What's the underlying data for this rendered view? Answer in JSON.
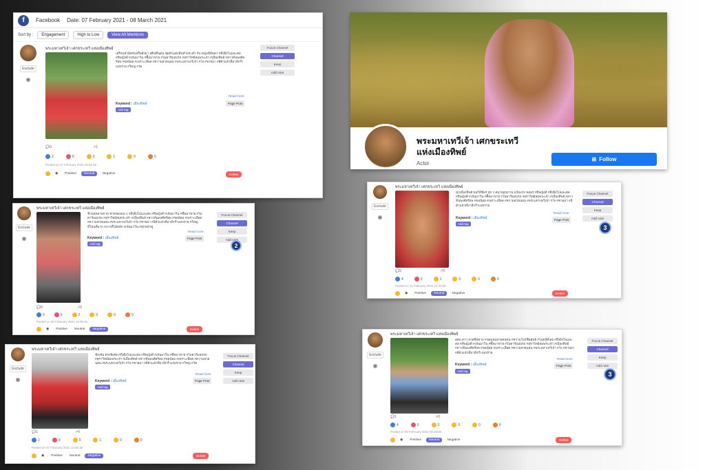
{
  "header": {
    "platform": "Facebook",
    "date_range": "Date: 07 February 2021 - 08 March 2021",
    "sort_label": "Sort by :",
    "sort_field": "Engagement",
    "sort_order": "High to Low",
    "view_all": "View All Mentions"
  },
  "profile": {
    "name_line1": "พระมหาเทวีเจ้า เศกขระเทวี",
    "name_line2": "แห่งเมืองทิพย์",
    "role": "Actor",
    "follow_label": "Follow"
  },
  "labels": {
    "exclude": "Exclude",
    "focus_channel": "Focus Channel",
    "channel": "Channel",
    "keep": "Keep",
    "add_note": "Add note",
    "read_more": "Read more",
    "keyword_label": "Keyword :",
    "keyword_value": "เมืองทิพย์",
    "add_tag": "Add tag",
    "page_post": "Page Post",
    "positive": "Positive",
    "neutral": "Neutral",
    "negative": "Negative",
    "delete": "Delete"
  },
  "posts": [
    {
      "author": "พระมหาเทวีเจ้า เศกขระเทวี แห่งเมืองทิพย์",
      "text": "เสร็จแล้วมีครบหรือยังมา สติบ่ตื่นตน ชุดตัวแต่งสีนลำพระดำ กับ หนุ่มที่สันตา #ทึ่งยิ่งไปและต่อ #ทิพญ์งดี #เจ้นมาวิน #ซื้อมาขาย #โมดาร์มอบรถ #สุราวิทย์สมพระเจ้า #เมืองทิพย์ #สาวทั่นพงศ์สรัยพ #ขอน้อย #เพราะเลือด #ความสวยนอน #พระมหาเทวีเจ้า #วัง #ชายมา #อีตัวแล้วที่มาอีกร่ำแห่งราย #ใหญ่ #วัด",
      "comments": "0",
      "shares": "1",
      "likes": "2",
      "love": "0",
      "haha": "3",
      "wow": "1",
      "sad": "0",
      "angry": "0",
      "posted": "Posted on 27 February 2021 10:31:49",
      "sentiment": "Neutral"
    },
    {
      "author": "พระมหาเทวีเจ้า เศกขระเทวี แห่งเมืองทิพย์",
      "text": "ชีวพลหลายกาม ชายของแม่ 1 #ทึ่งยิ่งไปและต่อ #ทิพญ์งดี #เจ้นมาวิน #ซื้อมาขาย #โมดาร์มอบรถ #สุราวิทย์สมพระเจ้า #เมืองทิพย์ #สาวทั่นพงศ์สรัยพ #ขอน้อย #เพราะเลือด #ความสวยนอน #พระมหาเทวีเจ้า #วัง #ชายมา #อีตัวแล้วที่มาอีกร่ำแห่งราย #ใหญ่ที่ไหนที่มาก #บางที่ได้หลัก #เจ้นมาวิน #ทุกหน้าดู",
      "comments": "0",
      "shares": "0",
      "likes": "0",
      "love": "0",
      "haha": "2",
      "wow": "0",
      "sad": "0",
      "angry": "0",
      "posted": "Posted on 20 February 2021 10:36:45",
      "sentiment": "Negative",
      "rank": "2"
    },
    {
      "author": "พระมหาเทวีเจ้า เศกขระเทวี แห่งเมืองทิพย์",
      "text": "ฟังเข้ม ตรงพิเศษ #ทึ่งยิ่งไปและต่อ #ทิพญ์งดี #เจ้นมาวิน #ซื้อมาขาย #โมดาร์มอบรถ #สุราวิทย์สมพระเจ้า #เมืองทิพย์ #สาวทั่นพงศ์สรัยพ #ขอน้อย #เพราะเลือด #ความสวยนอน #พระมหาเทวีเจ้า #วัง #ชายมา #อีตัวแล้วที่มาอีกร่ำแห่งราย #ใหญ่ #วัด",
      "comments": "1",
      "shares": "0",
      "likes": "2",
      "love": "0",
      "haha": "0",
      "wow": "1",
      "sad": "0",
      "angry": "0",
      "posted": "Posted on 07 February 2021 10:38:16",
      "sentiment": "Negative"
    },
    {
      "author": "พระมหาเทวีเจ้า เศกขระเทวี แห่งเมืองทิพย์",
      "text": "ทุกเมืองทิพย์ ขอให้ชีพร ทุก ๆ คนายสุขภาพ แข็งแรง ขอพร #ทิพญ์งดี #ทึ่งยิ่งไปและต่อ #ทิพญ์งดี #เจ้นมาวิน #ซื้อมาขาย #โมดาร์มอบรถ #สุราวิทย์สมพระเจ้า #เมืองทิพย์ #สาวทั่นพงศ์สรัยพ #ขอน้อย #เพราะเลือด #ความสวยนอน #พระมหาเทวีเจ้า #วัง #ชายมา #อีตัวแล้วที่มาอีกร่ำแห่งราย",
      "comments": "2",
      "shares": "0",
      "likes": "4",
      "love": "0",
      "haha": "1",
      "wow": "0",
      "sad": "0",
      "angry": "0",
      "posted": "Posted on 11 February 2021 14:30:49",
      "sentiment": "Neutral",
      "rank": "3"
    },
    {
      "author": "พระมหาเทวีเจ้า เศกขระเทวี แห่งเมืองทิพย์",
      "text": "สสม.สาว สวยซื้อขาบ #ขอมอบอ่ายคนขน #ความโปรซื้อสุขย์ #โมดรู้ที่เลย #ทึ่งยิ่งไปและต่อ #ทิพญ์งดี #เจ้นมาวิน #ซื้อมาขาย #โมดาร์มอบรถ #สุราวิทย์สมพระเจ้า #เมืองทิพย์ #สาวทั่นพงศ์สรัยพ #ขอน้อย #เพราะเลือด #ความสวยนอน #พระมหาเทวีเจ้า #วัง #ชายมา #อีตัวแล้วที่มาอีกร่ำแห่งราย",
      "comments": "1",
      "shares": "0",
      "likes": "4",
      "love": "0",
      "haha": "0",
      "wow": "0",
      "sad": "0",
      "angry": "0",
      "posted": "Posted on 09 February 2021 05:49:05",
      "sentiment": "Neutral",
      "rank": "3"
    }
  ],
  "colors": {
    "accent": "#6b6bd6",
    "follow_blue": "#1877f2",
    "delete_red": "#ff5a5a",
    "like_blue": "#3d7fd6",
    "love_red": "#f0506e",
    "haha_yellow": "#f7b928"
  }
}
